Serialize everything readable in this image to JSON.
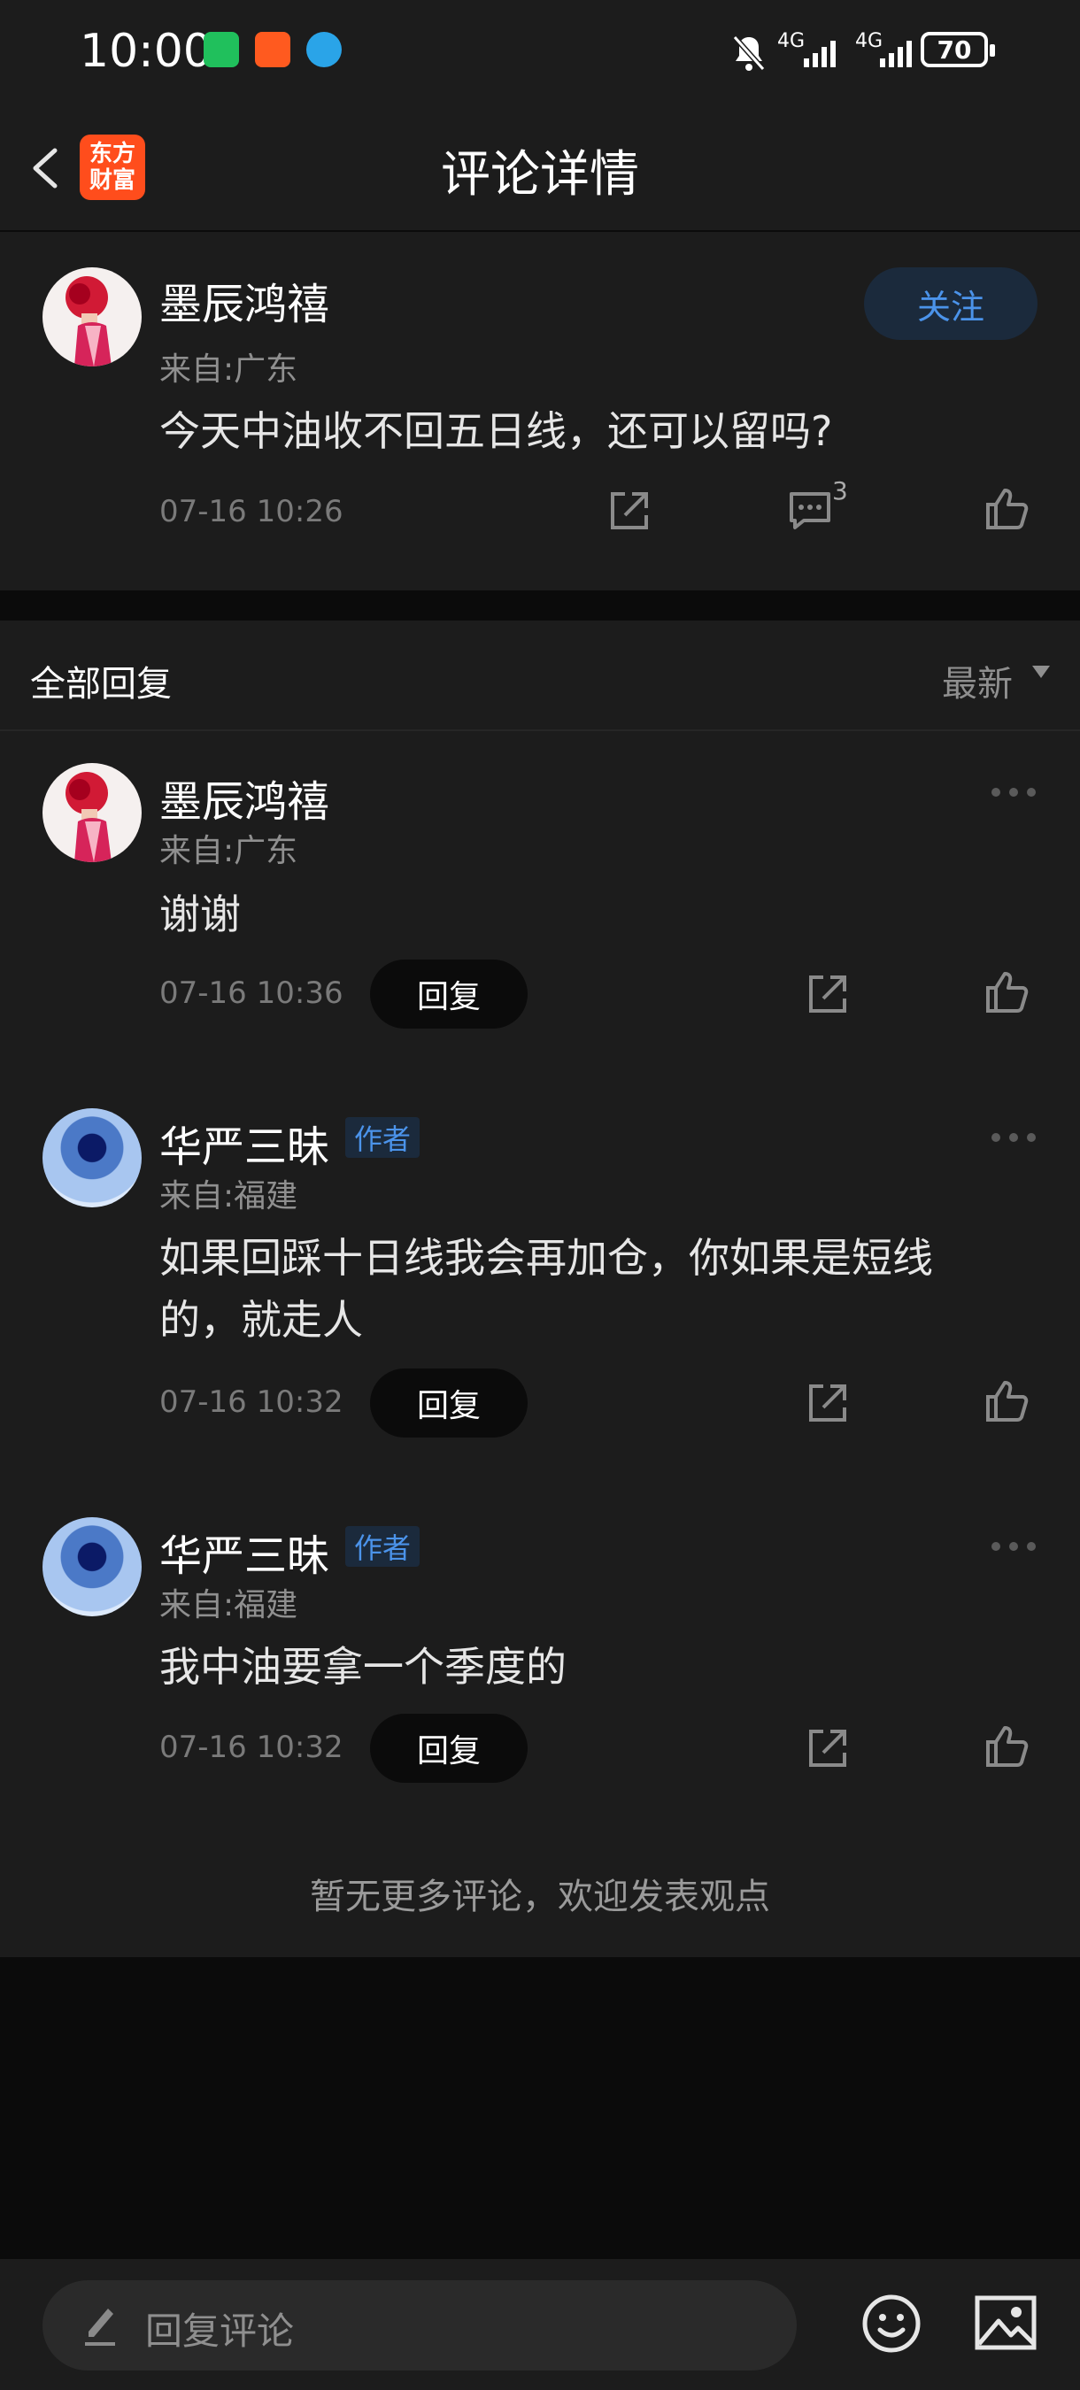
{
  "status_bar": {
    "time": "10:00",
    "network_1": "4G",
    "network_2": "4G",
    "battery": "70",
    "icons": [
      "wechat-icon",
      "app-icon",
      "browser-icon",
      "bell-muted-icon",
      "signal-icon"
    ]
  },
  "header": {
    "title": "评论详情",
    "logo_line1": "东方",
    "logo_line2": "财富",
    "icons": [
      "back-arrow-icon"
    ]
  },
  "post": {
    "username": "墨辰鸿禧",
    "location": "来自:广东",
    "follow_label": "关注",
    "content": "今天中油收不回五日线，还可以留吗?",
    "time": "07-16 10:26",
    "comment_count": "3",
    "icons": [
      "share-icon",
      "comment-icon",
      "like-icon"
    ]
  },
  "replies_section": {
    "title": "全部回复",
    "sort_label": "最新",
    "replies": [
      {
        "username": "墨辰鸿禧",
        "location": "来自:广东",
        "content": "谢谢",
        "time": "07-16 10:36",
        "reply_label": "回复",
        "author_badge": ""
      },
      {
        "username": "华严三昧",
        "location": "来自:福建",
        "content": "如果回踩十日线我会再加仓，你如果是短线的，就走人",
        "time": "07-16 10:32",
        "reply_label": "回复",
        "author_badge": "作者"
      },
      {
        "username": "华严三昧",
        "location": "来自:福建",
        "content": "我中油要拿一个季度的",
        "time": "07-16 10:32",
        "reply_label": "回复",
        "author_badge": "作者"
      }
    ],
    "footer_note": "暂无更多评论，欢迎发表观点"
  },
  "bottom_bar": {
    "placeholder": "回复评论",
    "icons": [
      "pencil-icon",
      "emoji-icon",
      "image-icon"
    ]
  },
  "colors": {
    "background": "#0b0b0b",
    "card": "#1c1c1c",
    "accent_blue": "#4b93ea",
    "logo_orange": "#ff4d1c"
  }
}
